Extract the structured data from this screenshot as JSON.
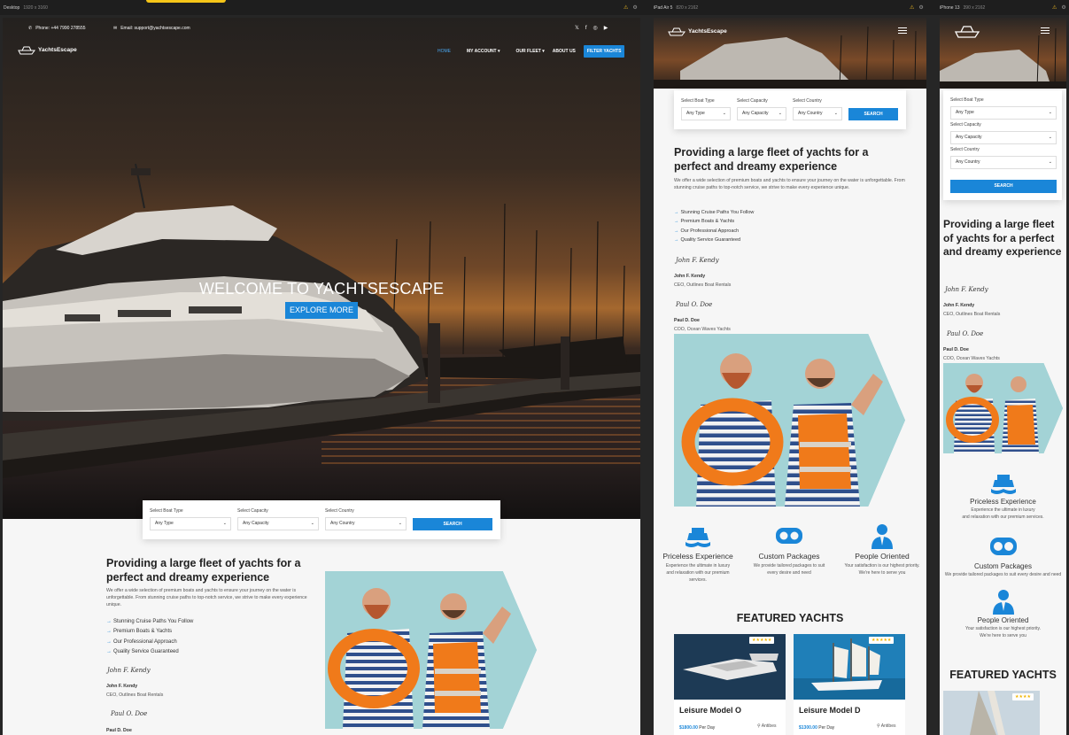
{
  "devices": [
    {
      "name": "Desktop",
      "size": "1920 x 3160"
    },
    {
      "name": "iPad Air 5",
      "size": "820 x 2162"
    },
    {
      "name": "iPhone 13",
      "size": "390 x 2162"
    }
  ],
  "site": {
    "brand": "YachtsEscape",
    "phone": "Phone: +44 7990 278555",
    "email": "Email: support@yachtsescape.com",
    "social": [
      "twitter-icon",
      "facebook-icon",
      "instagram-icon",
      "youtube-icon"
    ],
    "menu": [
      "HOME",
      "MY ACCOUNT",
      "OUR FLEET",
      "ABOUT US",
      "FILTER YACHTS"
    ],
    "hero_title": "WELCOME TO YACHTSESCAPE",
    "hero_button": "EXPLORE MORE"
  },
  "search": {
    "boat_type_label": "Select Boat Type",
    "boat_type_value": "Any Type",
    "capacity_label": "Select Capacity",
    "capacity_value": "Any Capacity",
    "country_label": "Select Country",
    "country_value": "Any Country",
    "button": "SEARCH"
  },
  "about": {
    "heading": "Providing a large fleet of yachts for a perfect and dreamy experience",
    "heading_line1": "Providing a large fleet of yachts for a",
    "heading_line2": "perfect and dreamy experience",
    "body": "We offer a wide selection of premium boats and yachts to ensure your journey on the water is unforgettable. From stunning cruise paths to top-notch service, we strive to make every experience unique.",
    "bullets": [
      "Stunning Cruise Paths You Follow",
      "Premium Boats & Yachts",
      "Our Professional Approach",
      "Quality Service Guaranteed"
    ],
    "people": [
      {
        "signature": "John F. Kendy",
        "name": "John F. Kendy",
        "role": "CEO, Outlines Boat Rentals"
      },
      {
        "signature": "Paul O. Doe",
        "name": "Paul D. Doe",
        "role": "COO, Ocean Waves Yachts"
      }
    ]
  },
  "features": [
    {
      "icon": "ship-icon",
      "title": "Priceless Experience",
      "desc_line1": "Experience the ultimate in luxury",
      "desc_line2": "and relaxation with our premium",
      "desc_line3": "services.",
      "desc_m1": "Experience the ultimate in luxury",
      "desc_m2": "and relaxation with our premium services."
    },
    {
      "icon": "vr-goggles-icon",
      "title": "Custom Packages",
      "desc_line1": "We provide tailored packages to suit",
      "desc_line2": "every desire and need",
      "desc_m1": "We provide tailored packages to suit every desire and need"
    },
    {
      "icon": "person-icon",
      "title": "People Oriented",
      "desc_line1": "Your satisfaction is our highest priority.",
      "desc_line2": "We're here to serve you",
      "desc_m1": "Your satisfaction is our highest priority.",
      "desc_m2": "We're here to serve you"
    }
  ],
  "featured": {
    "title": "FEATURED YACHTS",
    "cards": [
      {
        "name": "Leisure Model O",
        "price": "$1800.00",
        "per": "Per Day",
        "location": "Antibes",
        "stars": "★★★★★"
      },
      {
        "name": "Leisure Model D",
        "price": "$1300.00",
        "per": "Per Day",
        "location": "Antibes",
        "stars": "★★★★★"
      }
    ],
    "mobile_stars": "★★★★"
  }
}
